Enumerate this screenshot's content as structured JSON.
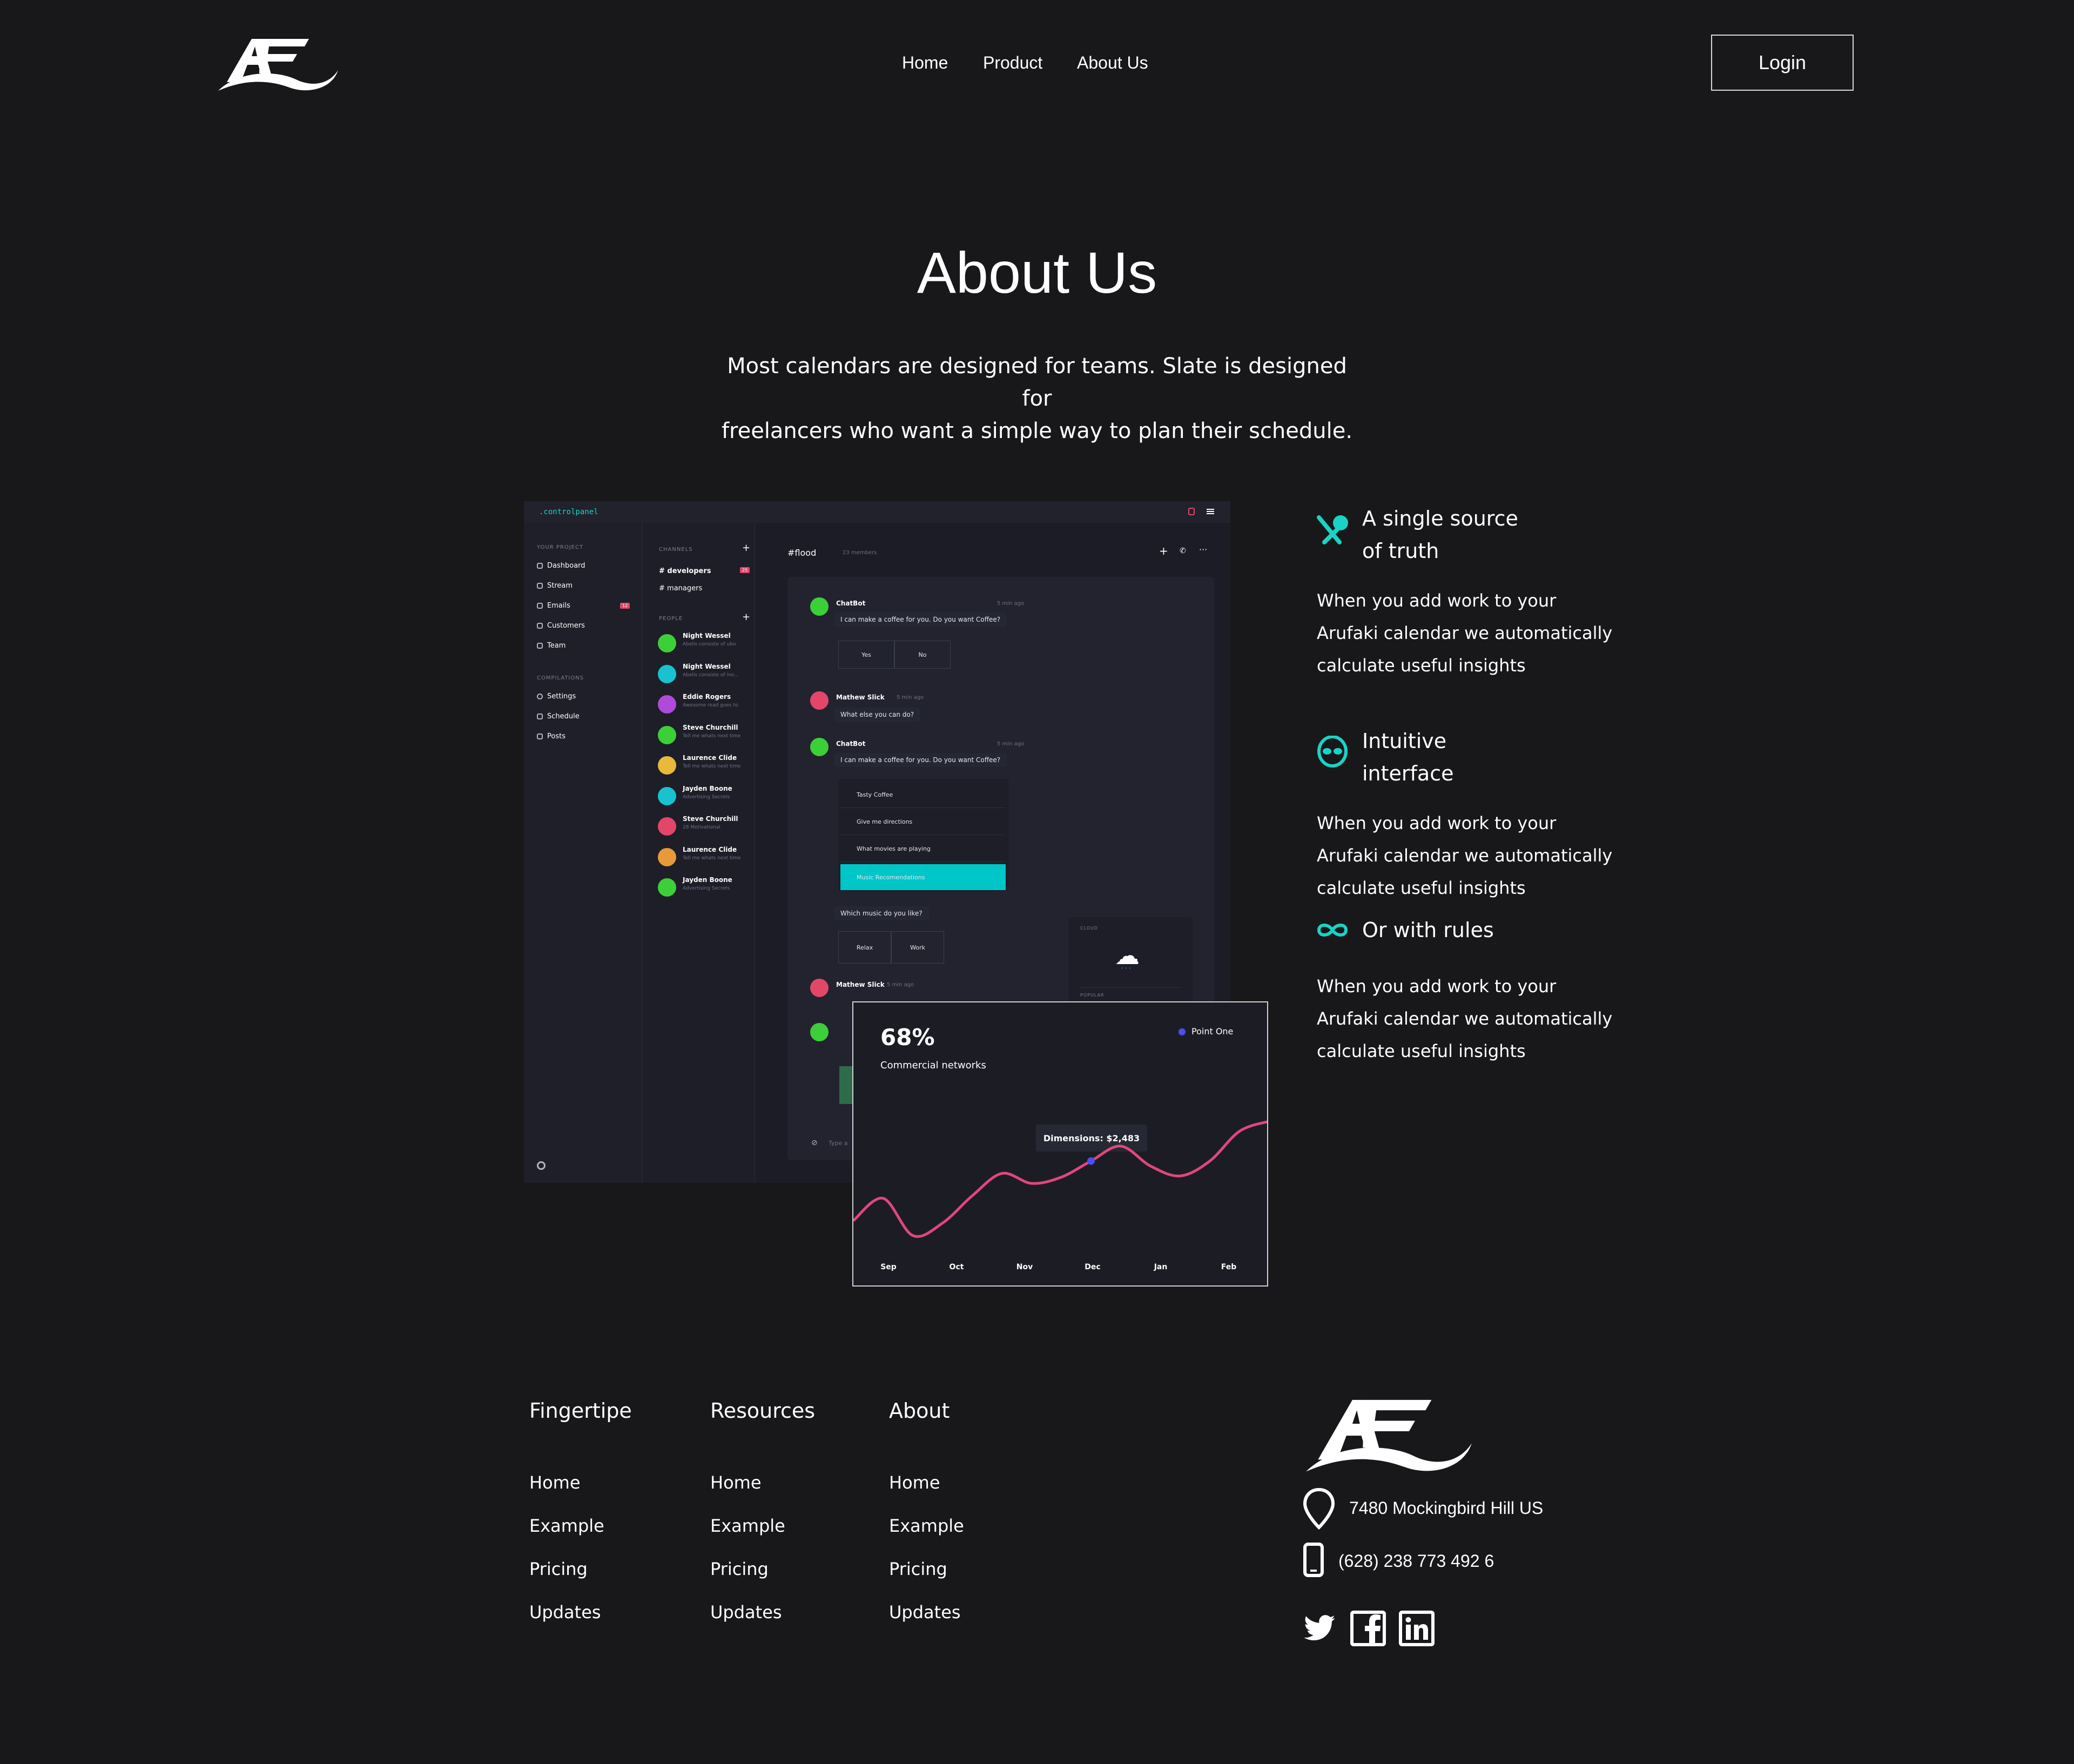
{
  "header": {
    "nav": [
      "Home",
      "Product",
      "About Us"
    ],
    "login_label": "Login"
  },
  "hero": {
    "title": "About Us",
    "subtitle_line1": "Most calendars are designed for teams. Slate is designed for",
    "subtitle_line2": "freelancers who want a simple way to plan their schedule."
  },
  "features": [
    {
      "icon": "pin-x-icon",
      "title_line1": "A single source",
      "title_line2": "of truth",
      "body": [
        "When you add work to your",
        "Arufaki calendar we automatically",
        "calculate useful insights"
      ]
    },
    {
      "icon": "alien-icon",
      "title_line1": "Intuitive",
      "title_line2": "interface",
      "body": [
        "When you add work to your",
        "Arufaki calendar we automatically",
        "calculate useful insights"
      ]
    },
    {
      "icon": "infinity-icon",
      "title_line1": "Or with rules",
      "title_line2": "",
      "body": [
        "When you add work to your",
        "Arufaki calendar we automatically",
        "calculate useful insights"
      ]
    }
  ],
  "accent_color": "#19d3c5",
  "mockup": {
    "brand": ".controlpanel",
    "your_project": "YOUR PROJECT",
    "nav": [
      "Dashboard",
      "Stream",
      "Emails",
      "Customers",
      "Team"
    ],
    "emails_badge": "12",
    "compilations": "COMPILATIONS",
    "compilation_items": [
      "Settings",
      "Schedule",
      "Posts"
    ],
    "channels_label": "CHANNELS",
    "channels": [
      "# developers",
      "# managers"
    ],
    "channel_badge": "25",
    "people_label": "PEOPLE",
    "people": [
      {
        "name": "Night Wessel",
        "sub": "Abelis consiste of ubo",
        "color": "#3ccf3a",
        "initials": "NW"
      },
      {
        "name": "Night Wessel",
        "sub": "Abelis consiste of ino...",
        "color": "#19c2cf",
        "initials": "NW"
      },
      {
        "name": "Eddie Rogers",
        "sub": "Awesome read goes to",
        "color": "#b04ad8",
        "initials": "ER"
      },
      {
        "name": "Steve Churchill",
        "sub": "Tell me whats next time",
        "color": "#3ccf3a",
        "initials": "SC"
      },
      {
        "name": "Laurence Clide",
        "sub": "Tell me whats next time",
        "color": "#e8b93a",
        "initials": "LC"
      },
      {
        "name": "Jayden Boone",
        "sub": "Advertising Secrets",
        "color": "#19c2cf",
        "initials": "JB"
      },
      {
        "name": "Steve Churchill",
        "sub": "28 Motivational",
        "color": "#e2476a",
        "initials": "SC"
      },
      {
        "name": "Laurence Clide",
        "sub": "Tell me whats next time",
        "color": "#e89a3a",
        "initials": "LC"
      },
      {
        "name": "Jayden Boone",
        "sub": "Advertising Secrets",
        "color": "#3ccf3a",
        "initials": "JB"
      }
    ],
    "chat": {
      "channel": "#flood",
      "members": "23 members",
      "bot_name": "ChatBot",
      "bot_time": "5 min ago",
      "bot_msg": "I can make a coffee for you. Do you want Coffee?",
      "yes": "Yes",
      "no": "No",
      "user_name": "Mathew Slick",
      "user_time": "5 min ago",
      "user_msg": "What else you can do?",
      "menu": [
        "Tasty Coffee",
        "Give me directions",
        "What movies are playing",
        "Music Recomendations"
      ],
      "question": "Which music do you like?",
      "relax": "Relax",
      "work": "Work",
      "weather_label": "CLOUD",
      "popular_label": "POPULAR",
      "input_placeholder": "Type a"
    }
  },
  "chart_data": {
    "type": "line",
    "title": "68%",
    "subtitle": "Commercial networks",
    "series": [
      {
        "name": "Point One",
        "color": "#e0477c",
        "values": [
          20,
          38,
          8,
          18,
          40,
          58,
          50,
          55,
          68,
          80,
          64,
          56,
          68,
          92,
          100
        ]
      }
    ],
    "x_ticks": [
      "Sep",
      "Oct",
      "Nov",
      "Dec",
      "Jan",
      "Feb"
    ],
    "tooltip": "Dimensions: $2,483",
    "legend_dot_color": "#4c4ef0"
  },
  "footer": {
    "columns": [
      {
        "title": "Fingertipe",
        "links": [
          "Home",
          "Example",
          "Pricing",
          "Updates"
        ]
      },
      {
        "title": "Resources",
        "links": [
          "Home",
          "Example",
          "Pricing",
          "Updates"
        ]
      },
      {
        "title": "About",
        "links": [
          "Home",
          "Example",
          "Pricing",
          "Updates"
        ]
      }
    ],
    "address": "7480 Mockingbird Hill US",
    "phone": "(628) 238 773 492 6",
    "social": [
      "twitter-icon",
      "facebook-icon",
      "linkedin-icon"
    ]
  }
}
